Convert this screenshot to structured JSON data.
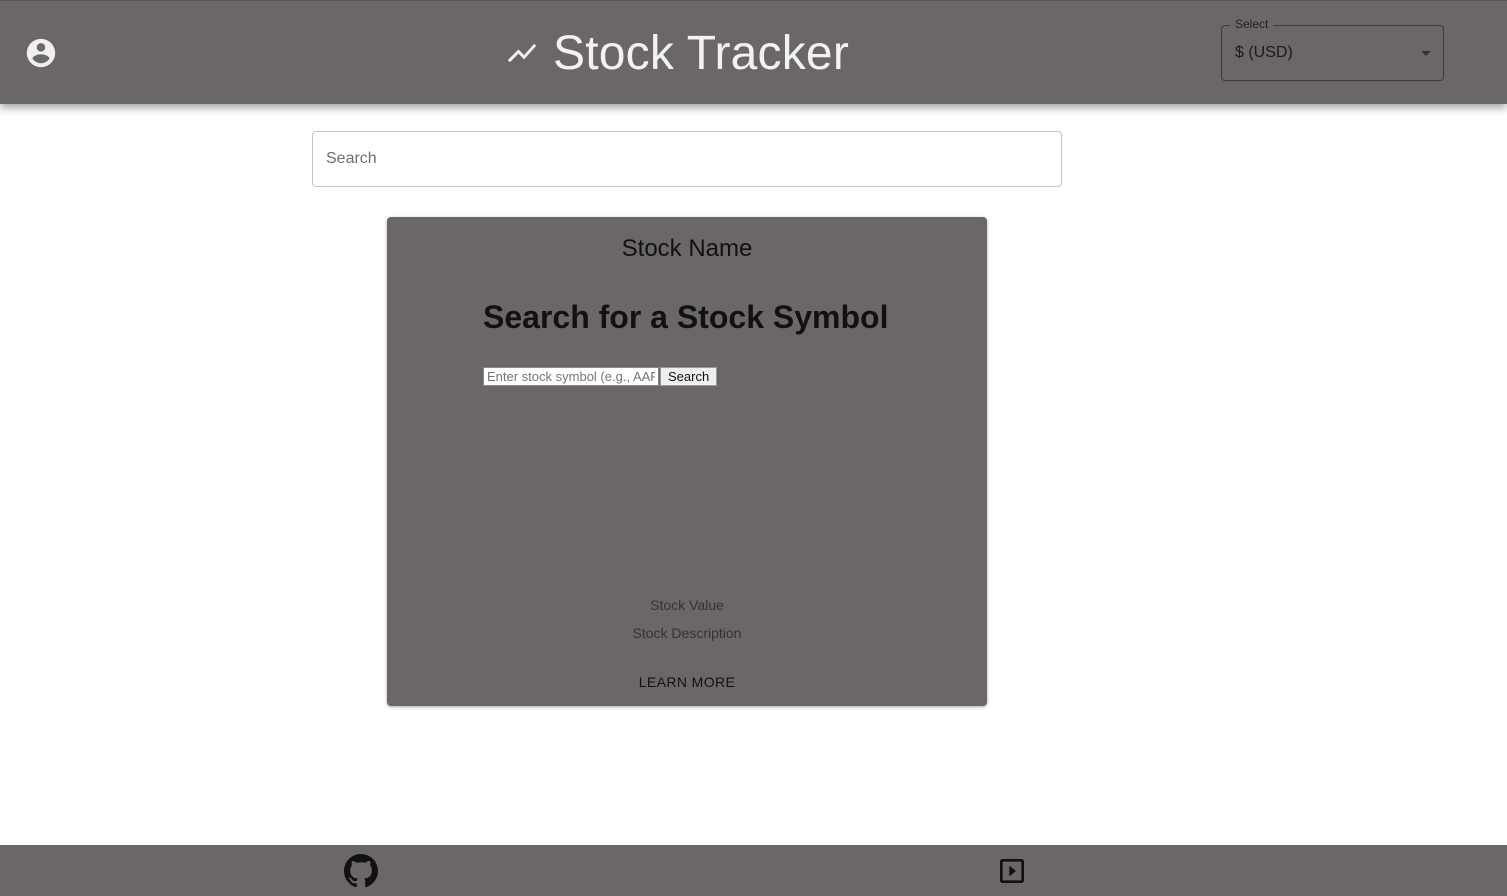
{
  "header": {
    "account_icon": "account-circle-icon",
    "trend_icon": "trending-up-icon",
    "title": "Stock Tracker",
    "currency_select": {
      "label": "Select",
      "value": "$ (USD)",
      "arrow_icon": "arrow-drop-down-icon"
    }
  },
  "search": {
    "placeholder": "Search",
    "value": ""
  },
  "card": {
    "title": "Stock Name",
    "heading": "Search for a Stock Symbol",
    "symbol_input": {
      "placeholder": "Enter stock symbol (e.g., AAPL)",
      "value": ""
    },
    "search_button": "Search",
    "stock_value": "Stock Value",
    "stock_description": "Stock Description",
    "learn_more": "LEARN MORE"
  },
  "footer": {
    "github_icon": "github-icon",
    "video_icon": "slideshow-icon"
  },
  "colors": {
    "header_bg": "#6b6768",
    "card_bg": "#6b6768",
    "footer_bg": "#6b6768",
    "title_text": "#f2f2f2"
  }
}
